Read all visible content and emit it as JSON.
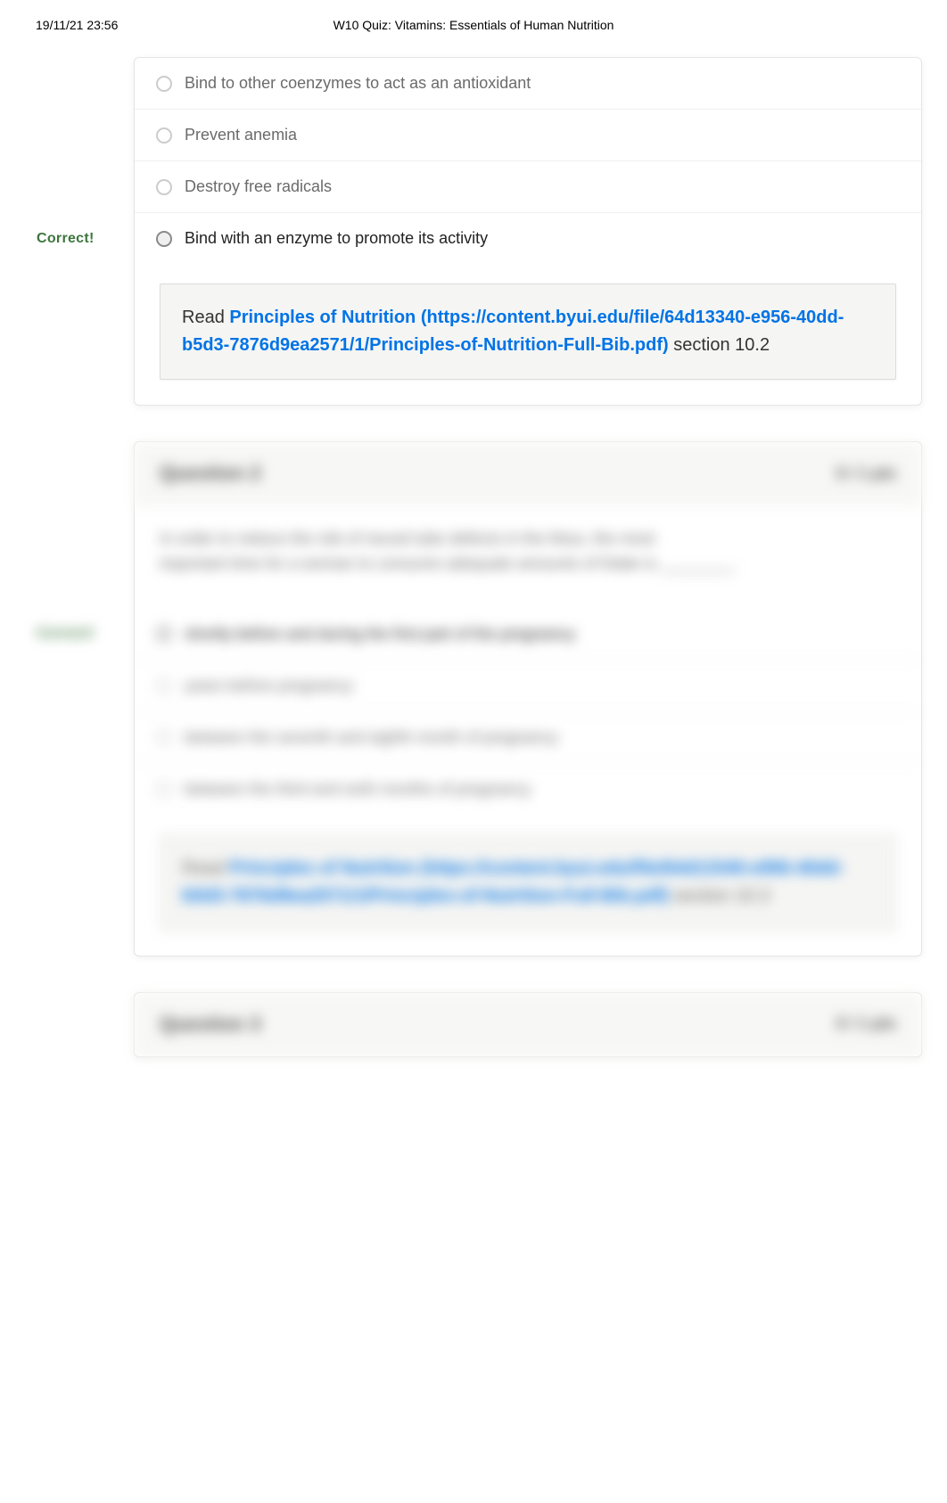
{
  "print": {
    "datetime": "19/11/21 23:56",
    "title": "W10 Quiz: Vitamins: Essentials of Human Nutrition"
  },
  "q1_partial": {
    "side_label": "Correct!",
    "answers": [
      {
        "text": "Bind to other coenzymes to act as an antioxidant",
        "selected": false
      },
      {
        "text": "Prevent anemia",
        "selected": false
      },
      {
        "text": "Destroy free radicals",
        "selected": false
      },
      {
        "text": "Bind with an enzyme to promote its activity",
        "selected": true
      }
    ],
    "feedback": {
      "prefix": "Read",
      "link_text": "Principles of Nutrition (https://content.byui.edu/file/64d13340-e956-40dd-b5d3-7876d9ea2571/1/Principles-of-Nutrition-Full-Bib.pdf)",
      "suffix": " section 10.2"
    }
  },
  "q2": {
    "title": "Question 2",
    "pts": "0 / 1 pts",
    "side_label": "Correct!",
    "stem_line1": "In order to reduce the risk of neural tube defects in the fetus, the most",
    "stem_line2": "important time for a woman to consume adequate amounts of folate is ________.",
    "answers": [
      {
        "text": "shortly before and during the first part of the pregnancy",
        "selected": true
      },
      {
        "text": "years before pregnancy",
        "selected": false
      },
      {
        "text": "between the seventh and eighth month of pregnancy",
        "selected": false
      },
      {
        "text": "between the third and sixth months of pregnancy",
        "selected": false
      }
    ],
    "feedback": {
      "prefix": "Read",
      "link_text": "Principles of Nutrition (https://content.byui.edu/file/64d13340-e956-40dd-b5d3-7876d9ea2571/1/Principles-of-Nutrition-Full-Bib.pdf)",
      "suffix": " section 10.3"
    }
  },
  "q3": {
    "title": "Question 3",
    "pts": "0 / 1 pts"
  }
}
